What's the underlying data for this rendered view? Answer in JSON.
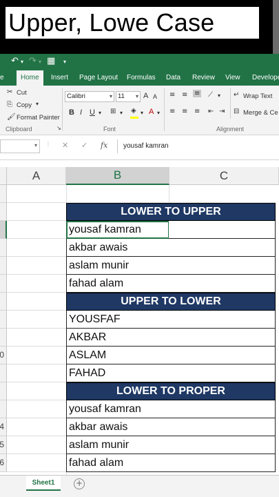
{
  "banner": {
    "title": "Upper, Lowe Case"
  },
  "ribbon_tabs": [
    "Home",
    "Insert",
    "Page Layout",
    "Formulas",
    "Data",
    "Review",
    "View",
    "Develope"
  ],
  "clipboard": {
    "cut": "Cut",
    "copy": "Copy",
    "format_painter": "Format Painter",
    "group": "Clipboard"
  },
  "font": {
    "name": "Calibri",
    "size": "11",
    "group": "Font",
    "bold": "B",
    "italic": "I",
    "underline": "U",
    "grow": "A",
    "shrink": "A"
  },
  "alignment": {
    "wrap": "Wrap Text",
    "merge": "Merge & Ce",
    "group": "Alignment"
  },
  "formula_bar": {
    "content": "yousaf kamran",
    "fx": "fx",
    "cancel": "✕",
    "enter": "✓"
  },
  "columns": [
    "A",
    "B",
    "C"
  ],
  "sections": [
    {
      "header": "LOWER TO UPPER",
      "rows": [
        "yousaf kamran",
        "akbar awais",
        "aslam munir",
        "fahad alam"
      ]
    },
    {
      "header": "UPPER TO LOWER",
      "rows": [
        "YOUSFAF",
        "AKBAR",
        "ASLAM",
        "FAHAD"
      ]
    },
    {
      "header": "LOWER TO PROPER",
      "rows": [
        "yousaf kamran",
        "akbar awais",
        "aslam munir",
        "fahad alam"
      ]
    }
  ],
  "row_numbers": [
    "0",
    "4",
    "5",
    "6"
  ],
  "sheet": {
    "name": "Sheet1",
    "add": "+"
  },
  "colors": {
    "excel_green": "#217346",
    "header_fill": "#1f3864"
  }
}
